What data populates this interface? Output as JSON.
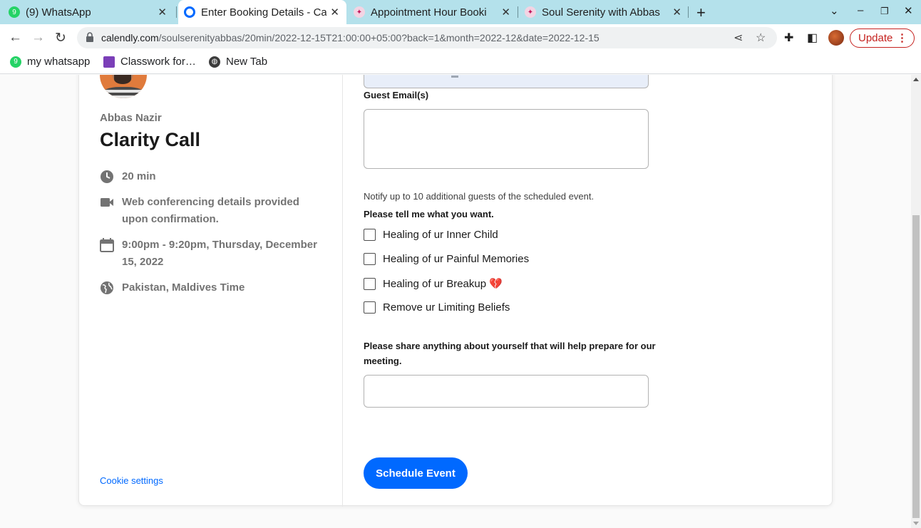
{
  "tabs": [
    {
      "title": "(9) WhatsApp",
      "icon": "whatsapp-icon",
      "badge": "9"
    },
    {
      "title": "Enter Booking Details - Ca",
      "icon": "calendly-icon",
      "active": true
    },
    {
      "title": "Appointment Hour Booki",
      "icon": "hummingbird-icon"
    },
    {
      "title": "Soul Serenity with Abbas",
      "icon": "hummingbird-icon"
    }
  ],
  "address_bar": {
    "url_host": "calendly.com",
    "url_path": "/soulserenityabbas/20min/2022-12-15T21:00:00+05:00?back=1&month=2022-12&date=2022-12-15"
  },
  "update_label": "Update",
  "bookmarks": [
    {
      "label": "my whatsapp",
      "badge": "9"
    },
    {
      "label": "Classwork for…"
    },
    {
      "label": "New Tab"
    }
  ],
  "sidebar": {
    "host_name": "Abbas Nazir",
    "event_title": "Clarity Call",
    "duration": "20 min",
    "conferencing": "Web conferencing details provided upon confirmation.",
    "datetime": "9:00pm - 9:20pm, Thursday, December 15, 2022",
    "timezone": "Pakistan, Maldives Time",
    "cookie_settings": "Cookie settings"
  },
  "form": {
    "guest_email_label": "Guest Email(s)",
    "guest_note": "Notify up to 10 additional guests of the scheduled event.",
    "want_label": "Please tell me what you want.",
    "options": [
      "Healing of ur Inner Child",
      "Healing of ur Painful Memories",
      "Healing of ur Breakup 💔",
      "Remove ur Limiting Beliefs"
    ],
    "share_label": "Please share anything about yourself that will help prepare for our meeting.",
    "submit_label": "Schedule Event"
  },
  "colors": {
    "accent": "#0069ff",
    "tabstrip": "#b4e1eb",
    "update": "#c5221f"
  }
}
